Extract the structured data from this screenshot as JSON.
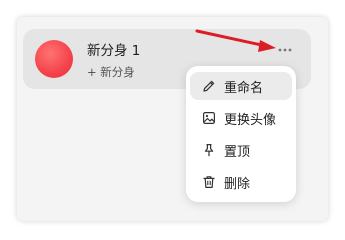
{
  "profile": {
    "name": "新分身 1",
    "subtitle": "+ 新分身",
    "more_icon": "ellipsis-icon",
    "avatar_color": "#f4434a"
  },
  "annotation": {
    "arrow_color": "#dc1d26"
  },
  "menu": {
    "items": [
      {
        "label": "重命名",
        "icon": "pencil-icon",
        "highlighted": true
      },
      {
        "label": "更换头像",
        "icon": "image-icon"
      },
      {
        "label": "置顶",
        "icon": "pin-icon"
      },
      {
        "label": "删除",
        "icon": "trash-icon"
      }
    ]
  }
}
